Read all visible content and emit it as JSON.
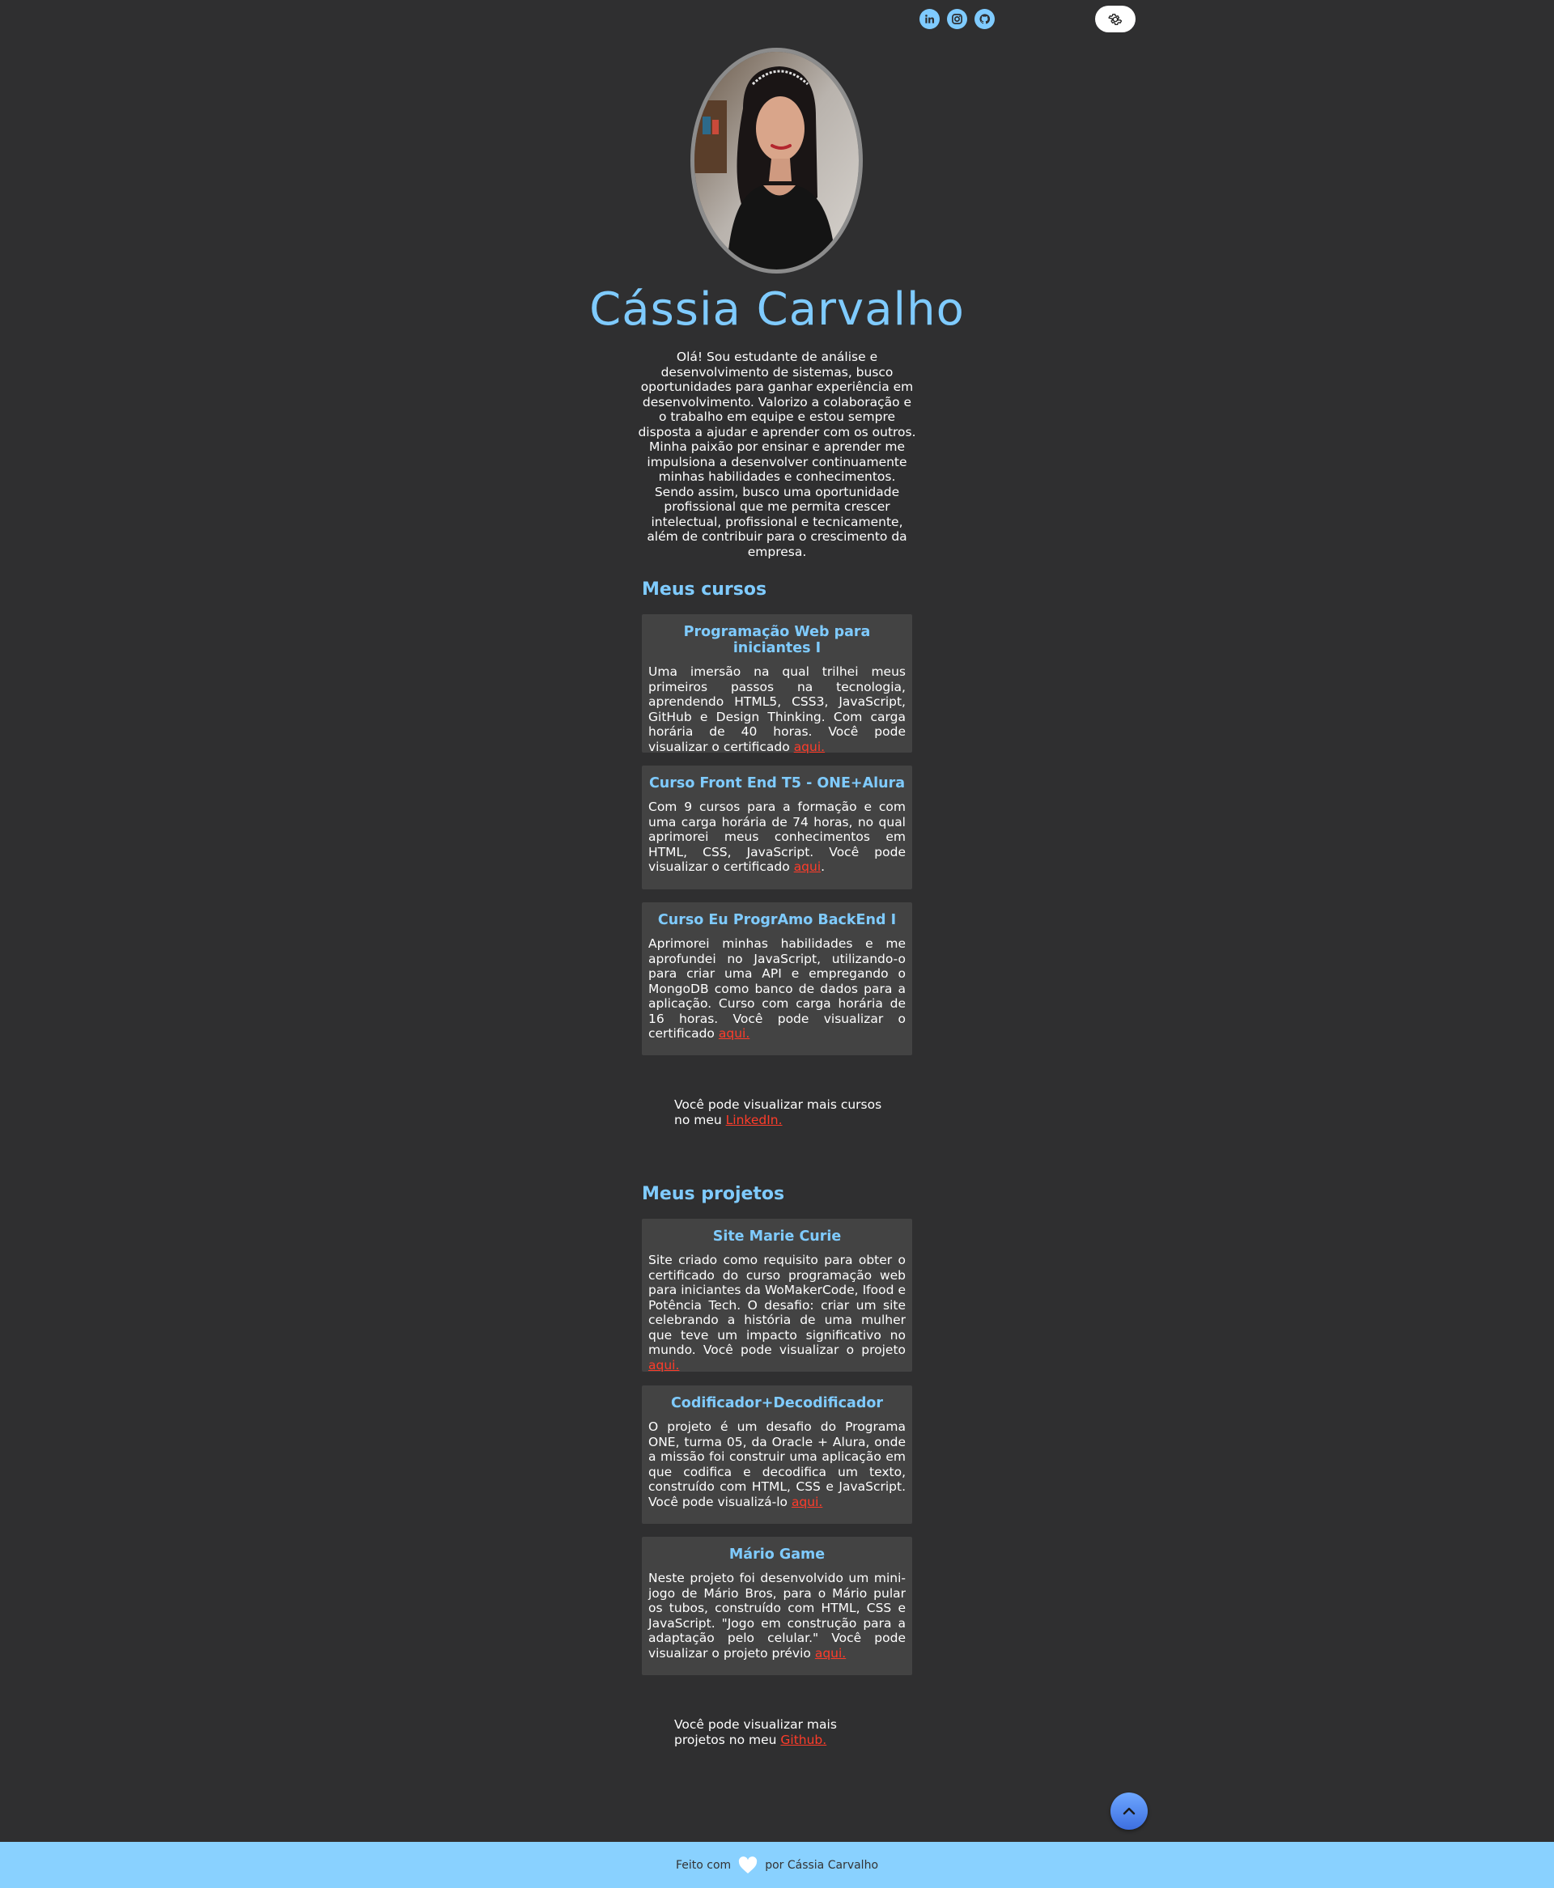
{
  "header": {
    "social_icons": [
      "linkedin-icon",
      "instagram-icon",
      "github-icon"
    ],
    "theme_icon": "gear-icon"
  },
  "profile": {
    "name": "Cássia Carvalho",
    "bio": "Olá! Sou estudante de análise e desenvolvimento de sistemas, busco oportunidades para ganhar experiência em desenvolvimento. Valorizo a colaboração e o trabalho em equipe e estou sempre disposta a ajudar e aprender com os outros. Minha paixão por ensinar e aprender me impulsiona a desenvolver continuamente minhas habilidades e conhecimentos. Sendo assim, busco uma oportunidade profissional que me permita crescer intelectual, profissional e tecnicamente, além de contribuir para o crescimento da empresa."
  },
  "courses": {
    "title": "Meus cursos",
    "items": [
      {
        "title": "Programação Web para iniciantes I",
        "text": "Uma imersão na qual trilhei meus primeiros passos na tecnologia, aprendendo HTML5, CSS3, JavaScript, GitHub e Design Thinking. Com carga horária de 40 horas. Você pode visualizar o certificado ",
        "link": "aqui.",
        "after": ""
      },
      {
        "title": "Curso Front End T5 - ONE+Alura",
        "text": "Com 9 cursos para a formação e com uma carga horária de 74 horas, no qual aprimorei meus conhecimentos em HTML, CSS, JavaScript. Você pode visualizar o certificado ",
        "link": "aqui",
        "after": "."
      },
      {
        "title": "Curso Eu ProgrAmo BackEnd I",
        "text": "Aprimorei minhas habilidades e me aprofundei no JavaScript, utilizando-o para criar uma API e empregando o MongoDB como banco de dados para a aplicação. Curso com carga horária de 16 horas. Você pode visualizar o certificado ",
        "link": "aqui.",
        "after": ""
      }
    ],
    "more_text": "Você pode visualizar mais cursos no meu ",
    "more_link": "LinkedIn."
  },
  "projects": {
    "title": "Meus projetos",
    "items": [
      {
        "title": "Site Marie Curie",
        "text": "Site criado como requisito para obter o certificado do curso programação web para iniciantes da WoMakerCode, Ifood e Potência Tech. O desafio: criar um site celebrando a história de uma mulher que teve um impacto significativo no mundo. Você pode visualizar o projeto ",
        "link": "aqui.",
        "after": ""
      },
      {
        "title": "Codificador+Decodificador",
        "text": "O projeto é um desafio do Programa ONE, turma 05, da Oracle + Alura, onde a missão foi construir uma aplicação em que codifica e decodifica um texto, construído com HTML, CSS e JavaScript. Você pode visualizá-lo ",
        "link": "aqui.",
        "after": ""
      },
      {
        "title": "Mário Game",
        "text": "Neste projeto foi desenvolvido um mini-jogo de Mário Bros, para o Mário pular os tubos, construído com HTML, CSS e JavaScript. \"Jogo em construção para a adaptação pelo celular.\" Você pode visualizar o projeto prévio ",
        "link": "aqui.",
        "after": ""
      }
    ],
    "more_text": "Você pode visualizar mais projetos no meu ",
    "more_link": "Github."
  },
  "footer": {
    "prefix": "Feito com",
    "suffix": "por Cássia Carvalho",
    "heart_icon": "heart-icon"
  },
  "colors": {
    "background": "#2f2f30",
    "accent": "#7fcbff",
    "link": "#ff3c2a",
    "card": "#434343",
    "footer": "#89d1ff"
  }
}
